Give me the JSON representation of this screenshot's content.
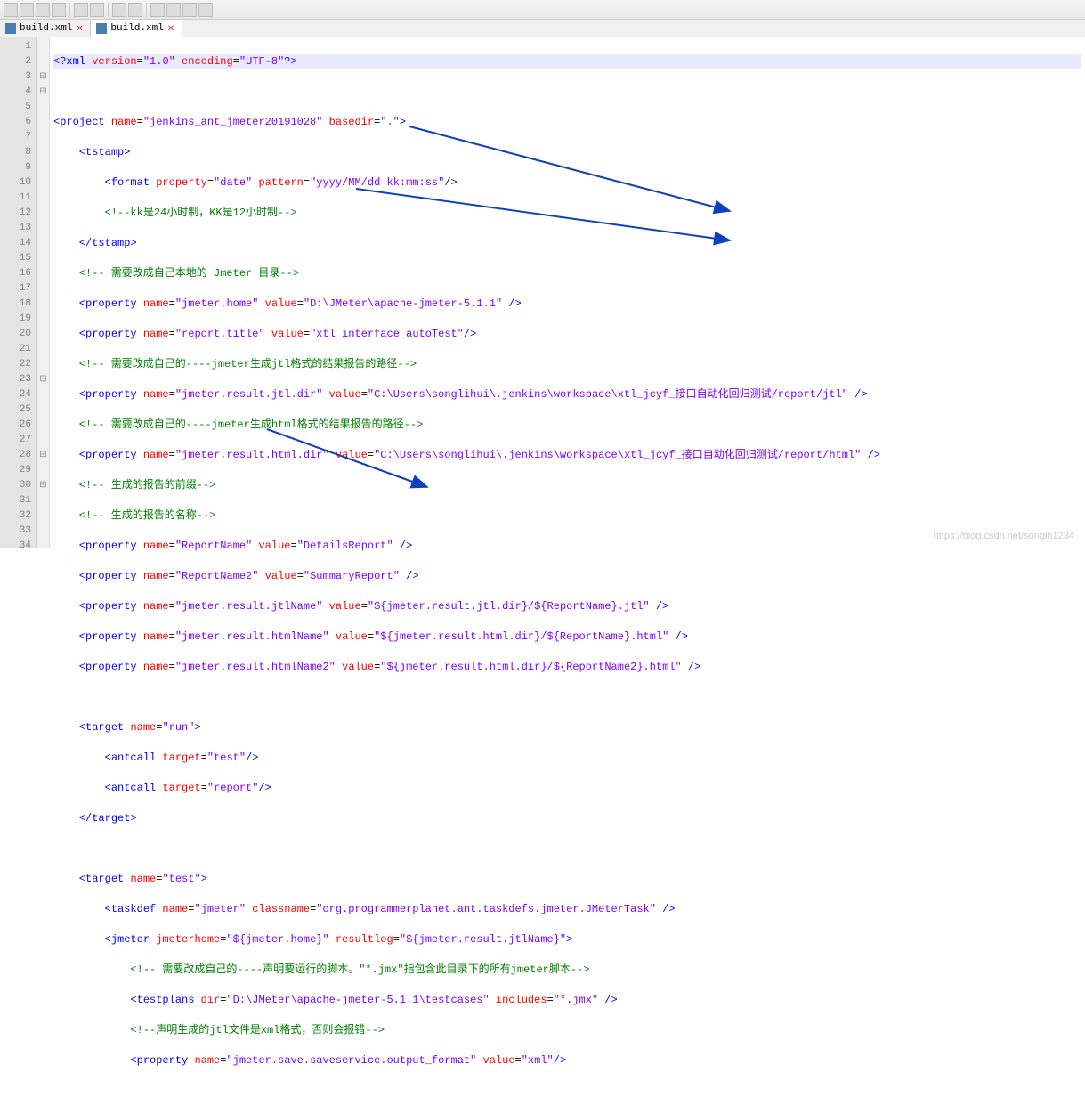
{
  "tabs": {
    "t1": "build.xml",
    "t2": "build.xml",
    "close": "✕"
  },
  "code": {
    "l1_a": "<?",
    "l1_b": "xml ",
    "l1_c": "version",
    "l1_d": "=",
    "l1_e": "\"1.0\"",
    "l1_f": " encoding",
    "l1_g": "=",
    "l1_h": "\"UTF-8\"",
    "l1_i": "?>",
    "l3_a": "<",
    "l3_b": "project ",
    "l3_c": "name",
    "l3_d": "=",
    "l3_e": "\"jenkins_ant_jmeter20191028\"",
    "l3_f": " basedir",
    "l3_g": "=",
    "l3_h": "\".\"",
    "l3_i": ">",
    "l4_a": "    <",
    "l4_b": "tstamp",
    "l4_c": ">",
    "l5_a": "        <",
    "l5_b": "format ",
    "l5_c": "property",
    "l5_d": "=",
    "l5_e": "\"date\"",
    "l5_f": " pattern",
    "l5_g": "=",
    "l5_h": "\"yyyy/MM/dd kk:mm:ss\"",
    "l5_i": "/>",
    "l6": "        <!--kk是24小时制，KK是12小时制-->",
    "l7_a": "    </",
    "l7_b": "tstamp",
    "l7_c": ">",
    "l8": "    <!-- 需要改成自己本地的 Jmeter 目录-->",
    "l9_a": "    <",
    "l9_b": "property ",
    "l9_c": "name",
    "l9_d": "=",
    "l9_e": "\"jmeter.home\"",
    "l9_f": " value",
    "l9_g": "=",
    "l9_h": "\"D:\\JMeter\\apache-jmeter-5.1.1\"",
    "l9_i": " />",
    "l10_a": "    <",
    "l10_b": "property ",
    "l10_c": "name",
    "l10_d": "=",
    "l10_e": "\"report.title\"",
    "l10_f": " value",
    "l10_g": "=",
    "l10_h": "\"xtl_interface_autoTest\"",
    "l10_i": "/>",
    "l11": "    <!-- 需要改成自己的----jmeter生成jtl格式的结果报告的路径-->",
    "l12_a": "    <",
    "l12_b": "property ",
    "l12_c": "name",
    "l12_d": "=",
    "l12_e": "\"jmeter.result.jtl.dir\"",
    "l12_f": " value",
    "l12_g": "=",
    "l12_h": "\"C:\\Users\\songlihui\\.jenkins\\workspace\\xtl_jcyf_接口自动化回归测试/report/jtl\"",
    "l12_i": " />",
    "l13": "    <!-- 需要改成自己的----jmeter生成html格式的结果报告的路径-->",
    "l14_a": "    <",
    "l14_b": "property ",
    "l14_c": "name",
    "l14_d": "=",
    "l14_e": "\"jmeter.result.html.dir\"",
    "l14_f": " value",
    "l14_g": "=",
    "l14_h": "\"C:\\Users\\songlihui\\.jenkins\\workspace\\xtl_jcyf_接口自动化回归测试/report/html\"",
    "l14_i": " />",
    "l15": "    <!-- 生成的报告的前缀-->",
    "l16": "    <!-- 生成的报告的名称-->",
    "l17_a": "    <",
    "l17_b": "property ",
    "l17_c": "name",
    "l17_d": "=",
    "l17_e": "\"ReportName\"",
    "l17_f": " value",
    "l17_g": "=",
    "l17_h": "\"DetailsReport\"",
    "l17_i": " />",
    "l18_a": "    <",
    "l18_b": "property ",
    "l18_c": "name",
    "l18_d": "=",
    "l18_e": "\"ReportName2\"",
    "l18_f": " value",
    "l18_g": "=",
    "l18_h": "\"SummaryReport\"",
    "l18_i": " />",
    "l19_a": "    <",
    "l19_b": "property ",
    "l19_c": "name",
    "l19_d": "=",
    "l19_e": "\"jmeter.result.jtlName\"",
    "l19_f": " value",
    "l19_g": "=",
    "l19_h": "\"${jmeter.result.jtl.dir}/${ReportName}.jtl\"",
    "l19_i": " />",
    "l20_a": "    <",
    "l20_b": "property ",
    "l20_c": "name",
    "l20_d": "=",
    "l20_e": "\"jmeter.result.htmlName\"",
    "l20_f": " value",
    "l20_g": "=",
    "l20_h": "\"${jmeter.result.html.dir}/${ReportName}.html\"",
    "l20_i": " />",
    "l21_a": "    <",
    "l21_b": "property ",
    "l21_c": "name",
    "l21_d": "=",
    "l21_e": "\"jmeter.result.htmlName2\"",
    "l21_f": " value",
    "l21_g": "=",
    "l21_h": "\"${jmeter.result.html.dir}/${ReportName2}.html\"",
    "l21_i": " />",
    "l23_a": "    <",
    "l23_b": "target ",
    "l23_c": "name",
    "l23_d": "=",
    "l23_e": "\"run\"",
    "l23_f": ">",
    "l24_a": "        <",
    "l24_b": "antcall ",
    "l24_c": "target",
    "l24_d": "=",
    "l24_e": "\"test\"",
    "l24_f": "/>",
    "l25_a": "        <",
    "l25_b": "antcall ",
    "l25_c": "target",
    "l25_d": "=",
    "l25_e": "\"report\"",
    "l25_f": "/>",
    "l26_a": "    </",
    "l26_b": "target",
    "l26_c": ">",
    "l28_a": "    <",
    "l28_b": "target ",
    "l28_c": "name",
    "l28_d": "=",
    "l28_e": "\"test\"",
    "l28_f": ">",
    "l29_a": "        <",
    "l29_b": "taskdef ",
    "l29_c": "name",
    "l29_d": "=",
    "l29_e": "\"jmeter\"",
    "l29_f": " classname",
    "l29_g": "=",
    "l29_h": "\"org.programmerplanet.ant.taskdefs.jmeter.JMeterTask\"",
    "l29_i": " />",
    "l30_a": "        <",
    "l30_b": "jmeter ",
    "l30_c": "jmeterhome",
    "l30_d": "=",
    "l30_e": "\"${jmeter.home}\"",
    "l30_f": " resultlog",
    "l30_g": "=",
    "l30_h": "\"${jmeter.result.jtlName}\"",
    "l30_i": ">",
    "l31": "            <!-- 需要改成自己的----声明要运行的脚本。\"*.jmx\"指包含此目录下的所有jmeter脚本-->",
    "l32_a": "            <",
    "l32_b": "testplans ",
    "l32_c": "dir",
    "l32_d": "=",
    "l32_e": "\"D:\\JMeter\\apache-jmeter-5.1.1\\testcases\"",
    "l32_f": " includes",
    "l32_g": "=",
    "l32_h": "\"*.jmx\"",
    "l32_i": " />",
    "l33": "            <!--声明生成的jtl文件是xml格式，否则会报错-->",
    "l34_a": "            <",
    "l34_b": "property ",
    "l34_c": "name",
    "l34_d": "=",
    "l34_e": "\"jmeter.save.saveservice.output_format\"",
    "l34_f": " value",
    "l34_g": "=",
    "l34_h": "\"xml\"",
    "l34_i": "/>"
  },
  "watermark": "https://blog.csdn.net/songlh1234"
}
